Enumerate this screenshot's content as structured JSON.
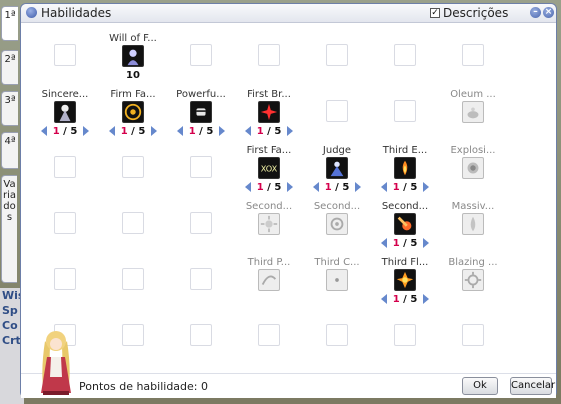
{
  "background": {
    "side_texts": [
      "Wis",
      "Sp",
      "Co",
      "Crt"
    ]
  },
  "tabs": [
    {
      "label": "1ª"
    },
    {
      "label": "2ª"
    },
    {
      "label": "3ª"
    },
    {
      "label": "4ª"
    },
    {
      "label": "Variados"
    }
  ],
  "window": {
    "title": "Habilidades",
    "descriptions_checkbox": {
      "label": "Descrições",
      "checked": true
    },
    "minimize_glyph": "–",
    "close_glyph": "×"
  },
  "skills": [
    {
      "id": "will",
      "name": "Will of F...",
      "col": 1,
      "row": 0,
      "type": "single",
      "level": "10",
      "icon": "praying-figure-icon",
      "enabled": true
    },
    {
      "id": "sincere",
      "name": "Sincere...",
      "col": 0,
      "row": 1,
      "type": "stepper",
      "current": "1",
      "max": "5",
      "icon": "robed-figure-icon",
      "enabled": true
    },
    {
      "id": "firmfa",
      "name": "Firm Fa...",
      "col": 1,
      "row": 1,
      "type": "stepper",
      "current": "1",
      "max": "5",
      "icon": "sun-emblem-icon",
      "enabled": true
    },
    {
      "id": "powerfu",
      "name": "Powerfu...",
      "col": 2,
      "row": 1,
      "type": "stepper",
      "current": "1",
      "max": "5",
      "icon": "fist-icon",
      "enabled": true
    },
    {
      "id": "firstbr",
      "name": "First Br...",
      "col": 3,
      "row": 1,
      "type": "stepper",
      "current": "1",
      "max": "5",
      "icon": "red-star-burst-icon",
      "enabled": true
    },
    {
      "id": "oleum",
      "name": "Oleum ...",
      "col": 7,
      "row": 1,
      "type": "disabled",
      "icon": "oil-lamp-icon",
      "enabled": false
    },
    {
      "id": "firstfa",
      "name": "First Fa...",
      "col": 3,
      "row": 2,
      "type": "stepper",
      "current": "1",
      "max": "5",
      "icon": "xox-rune-icon",
      "enabled": true
    },
    {
      "id": "judge",
      "name": "Judge",
      "col": 4,
      "row": 2,
      "type": "stepper",
      "current": "1",
      "max": "5",
      "icon": "blue-judge-figure-icon",
      "enabled": true
    },
    {
      "id": "thirde",
      "name": "Third E...",
      "col": 5,
      "row": 2,
      "type": "stepper",
      "current": "1",
      "max": "5",
      "icon": "flame-wings-icon",
      "enabled": true
    },
    {
      "id": "explosi",
      "name": "Explosi...",
      "col": 7,
      "row": 2,
      "type": "disabled",
      "icon": "explosion-orb-icon",
      "enabled": false
    },
    {
      "id": "second1",
      "name": "Second...",
      "col": 3,
      "row": 3,
      "type": "disabled",
      "icon": "radiant-sun-icon",
      "enabled": false
    },
    {
      "id": "second2",
      "name": "Second...",
      "col": 4,
      "row": 3,
      "type": "disabled",
      "icon": "circle-swirl-icon",
      "enabled": false
    },
    {
      "id": "second3",
      "name": "Second...",
      "col": 5,
      "row": 3,
      "type": "stepper",
      "current": "1",
      "max": "5",
      "icon": "fire-comet-icon",
      "enabled": true
    },
    {
      "id": "massiv",
      "name": "Massiv...",
      "col": 7,
      "row": 3,
      "type": "disabled",
      "icon": "flame-pillar-icon",
      "enabled": false
    },
    {
      "id": "thirdp",
      "name": "Third P...",
      "col": 3,
      "row": 4,
      "type": "disabled",
      "icon": "arc-swipe-icon",
      "enabled": false
    },
    {
      "id": "thirdc",
      "name": "Third C...",
      "col": 4,
      "row": 4,
      "type": "disabled",
      "icon": "dot-burst-icon",
      "enabled": false
    },
    {
      "id": "thirdfl",
      "name": "Third Fl...",
      "col": 5,
      "row": 4,
      "type": "stepper",
      "current": "1",
      "max": "5",
      "icon": "flame-burst-icon",
      "enabled": true
    },
    {
      "id": "blazing",
      "name": "Blazing ...",
      "col": 7,
      "row": 4,
      "type": "disabled",
      "icon": "blazing-sun-icon",
      "enabled": false
    }
  ],
  "footer": {
    "points_label": "Pontos de habilidade: 0",
    "ok_label": "Ok",
    "cancel_label": "Cancelar"
  },
  "colors": {
    "accent": "#6688cc",
    "level_current": "#d4004c",
    "window_border": "#6d7fa8"
  }
}
